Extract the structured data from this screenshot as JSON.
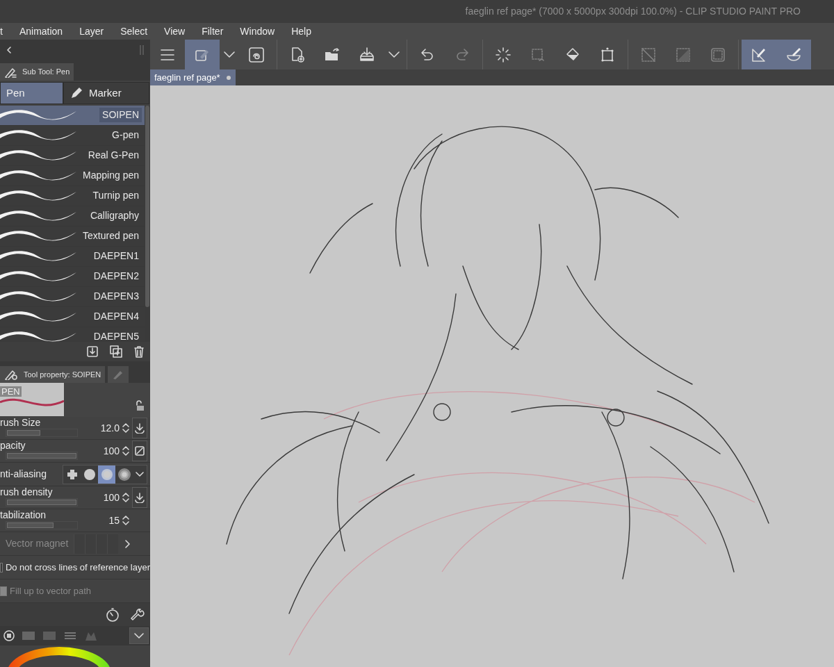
{
  "window": {
    "title": "faeglin ref page* (7000 x 5000px 300dpi 100.0%)  - CLIP STUDIO PAINT PRO"
  },
  "menu": [
    "t",
    "Animation",
    "Layer",
    "Select",
    "View",
    "Filter",
    "Window",
    "Help"
  ],
  "toolbar": [
    {
      "kind": "menu",
      "selected": false,
      "disabled": false
    },
    {
      "kind": "pen-link",
      "selected": true,
      "disabled": false
    },
    {
      "kind": "chevron",
      "selected": false,
      "disabled": false
    },
    {
      "kind": "swirl",
      "selected": false,
      "disabled": false
    },
    {
      "kind": "sep"
    },
    {
      "kind": "new-file",
      "selected": false,
      "disabled": false
    },
    {
      "kind": "open-folder",
      "selected": false,
      "disabled": false
    },
    {
      "kind": "tray",
      "selected": false,
      "disabled": false
    },
    {
      "kind": "chevron",
      "selected": false,
      "disabled": false
    },
    {
      "kind": "sep"
    },
    {
      "kind": "undo",
      "selected": false,
      "disabled": false
    },
    {
      "kind": "redo",
      "selected": false,
      "disabled": true
    },
    {
      "kind": "sep"
    },
    {
      "kind": "spinner",
      "selected": false,
      "disabled": false
    },
    {
      "kind": "dashed-square",
      "selected": false,
      "disabled": true
    },
    {
      "kind": "bucket",
      "selected": false,
      "disabled": false
    },
    {
      "kind": "transform",
      "selected": false,
      "disabled": false
    },
    {
      "kind": "sep"
    },
    {
      "kind": "diagonal",
      "selected": false,
      "disabled": true
    },
    {
      "kind": "half",
      "selected": false,
      "disabled": true
    },
    {
      "kind": "rounded-square",
      "selected": false,
      "disabled": true
    },
    {
      "kind": "sep"
    },
    {
      "kind": "ruler-pen",
      "selected": true,
      "disabled": false
    },
    {
      "kind": "bowl-pen",
      "selected": true,
      "disabled": false
    }
  ],
  "sub_tool": {
    "tab": "Sub Tool: Pen",
    "groups": [
      {
        "label": "Pen",
        "selected": true
      },
      {
        "label": "Marker",
        "selected": false
      }
    ],
    "brushes": [
      {
        "name": "SOIPEN",
        "selected": true
      },
      {
        "name": "G-pen",
        "selected": false
      },
      {
        "name": "Real G-Pen",
        "selected": false
      },
      {
        "name": "Mapping pen",
        "selected": false
      },
      {
        "name": "Turnip pen",
        "selected": false
      },
      {
        "name": "Calligraphy",
        "selected": false
      },
      {
        "name": "Textured pen",
        "selected": false
      },
      {
        "name": "DAEPEN1",
        "selected": false
      },
      {
        "name": "DAEPEN2",
        "selected": false
      },
      {
        "name": "DAEPEN3",
        "selected": false
      },
      {
        "name": "DAEPEN4",
        "selected": false
      },
      {
        "name": "DAEPEN5",
        "selected": false
      }
    ]
  },
  "tool_property": {
    "tab": "Tool property: SOIPEN",
    "preview_label": "PEN",
    "rows": [
      {
        "kind": "slider",
        "label": "rush Size",
        "value": "12.0",
        "level": 0.48,
        "button": {
          "kind": "download"
        }
      },
      {
        "kind": "slider",
        "label": "pacity",
        "value": "100",
        "level": 1.0,
        "button": {
          "kind": "reset"
        }
      },
      {
        "kind": "options",
        "label": "nti-aliasing",
        "options": [
          {
            "selected": false
          },
          {
            "selected": false
          },
          {
            "selected": true
          },
          {
            "selected": false
          }
        ]
      },
      {
        "kind": "slider",
        "label": "rush density",
        "value": "100",
        "level": 1.0,
        "button": {
          "kind": "download"
        }
      },
      {
        "kind": "slider",
        "label": "tabilization",
        "value": "15",
        "level": 0.67
      },
      {
        "kind": "magnet",
        "label": "Vector magnet",
        "disabled": true
      },
      {
        "kind": "checkbox",
        "label": "Do not cross lines of reference layer",
        "checked": false,
        "disabled": false
      },
      {
        "kind": "checkbox",
        "label": "Fill up to vector path",
        "checked": true,
        "disabled": true
      }
    ]
  },
  "document": {
    "tab": "faeglin ref page*"
  }
}
